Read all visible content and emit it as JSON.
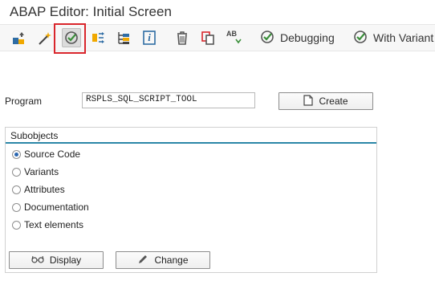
{
  "window": {
    "title": "ABAP Editor: Initial Screen"
  },
  "toolbar": {
    "debugging_label": "Debugging",
    "with_variant_label": "With Variant",
    "info_glyph": "i",
    "ab_glyph": "AB"
  },
  "form": {
    "program_label": "Program",
    "program_value": "RSPLS_SQL_SCRIPT_TOOL",
    "create_label": "Create"
  },
  "subobjects": {
    "title": "Subobjects",
    "options": [
      {
        "label": "Source Code",
        "selected": true
      },
      {
        "label": "Variants",
        "selected": false
      },
      {
        "label": "Attributes",
        "selected": false
      },
      {
        "label": "Documentation",
        "selected": false
      },
      {
        "label": "Text elements",
        "selected": false
      }
    ]
  },
  "actions": {
    "display_label": "Display",
    "change_label": "Change"
  },
  "colors": {
    "accent": "#2b86a7",
    "highlight": "#d9262c",
    "execute_green": "#3a8f3a"
  }
}
